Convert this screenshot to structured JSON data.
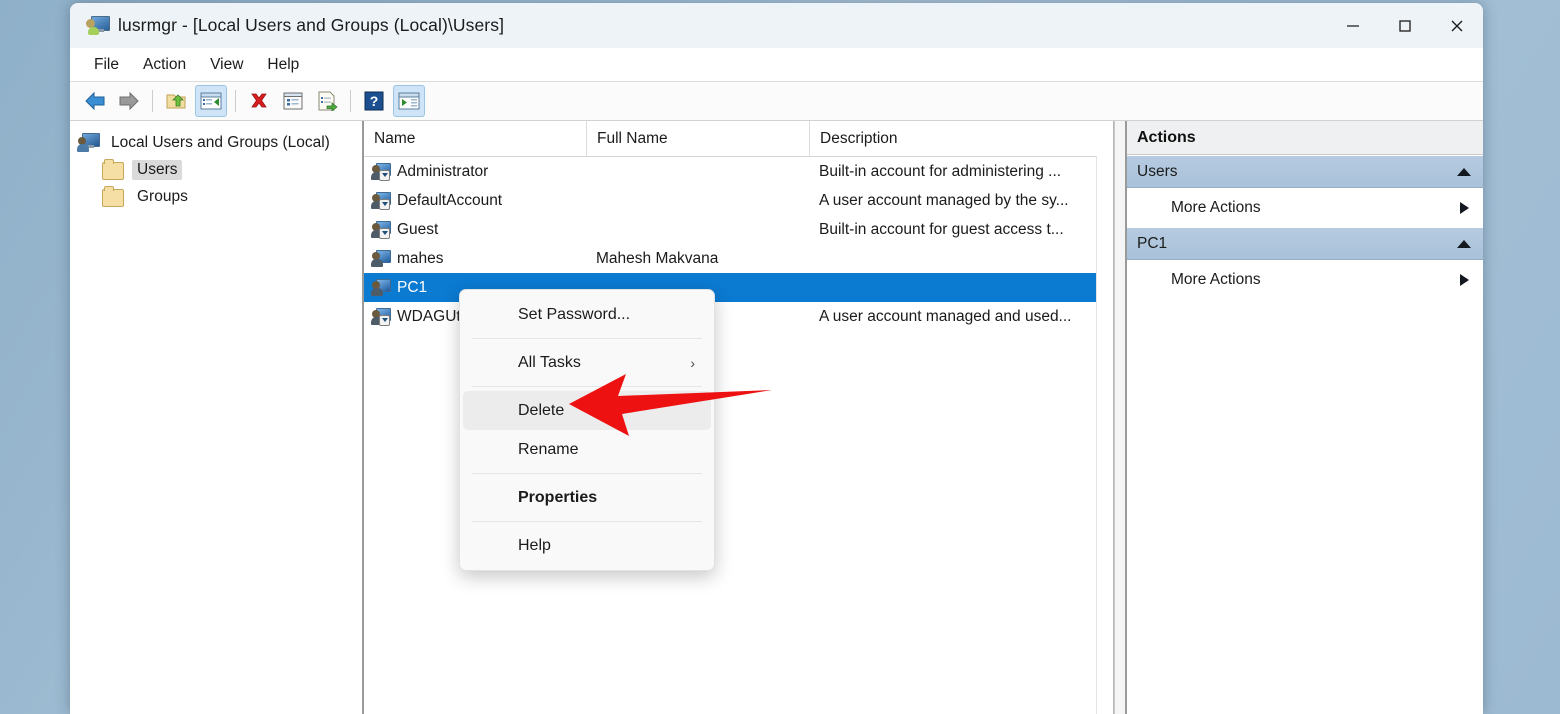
{
  "window": {
    "title": "lusrmgr - [Local Users and Groups (Local)\\Users]",
    "app_icon": "computer-users-icon",
    "controls": {
      "minimize": "minimize-icon",
      "maximize": "maximize-icon",
      "close": "close-icon"
    }
  },
  "menubar": {
    "items": [
      {
        "label": "File"
      },
      {
        "label": "Action"
      },
      {
        "label": "View"
      },
      {
        "label": "Help"
      }
    ]
  },
  "toolbar": {
    "buttons": [
      {
        "name": "back-icon",
        "glyph": "back"
      },
      {
        "name": "forward-icon",
        "glyph": "forward"
      },
      {
        "name": "up-one-level-icon",
        "glyph": "folder-up"
      },
      {
        "name": "show-hide-console-tree-icon",
        "glyph": "console-tree",
        "active": true
      },
      {
        "name": "delete-icon",
        "glyph": "delete-x"
      },
      {
        "name": "properties-icon",
        "glyph": "properties"
      },
      {
        "name": "export-list-icon",
        "glyph": "export-list"
      },
      {
        "name": "help-icon",
        "glyph": "help"
      },
      {
        "name": "show-hide-action-pane-icon",
        "glyph": "action-pane",
        "active": true
      }
    ]
  },
  "tree": {
    "root": {
      "label": "Local Users and Groups (Local)",
      "icon": "computer-icon"
    },
    "children": [
      {
        "label": "Users",
        "icon": "folder-icon",
        "selected": true
      },
      {
        "label": "Groups",
        "icon": "folder-icon",
        "selected": false
      }
    ]
  },
  "list": {
    "columns": [
      "Name",
      "Full Name",
      "Description"
    ],
    "rows": [
      {
        "name": "Administrator",
        "full_name": "",
        "description": "Built-in account for administering ...",
        "selected": false
      },
      {
        "name": "DefaultAccount",
        "full_name": "",
        "description": "A user account managed by the sy...",
        "selected": false
      },
      {
        "name": "Guest",
        "full_name": "",
        "description": "Built-in account for guest access t...",
        "selected": false
      },
      {
        "name": "mahes",
        "full_name": "Mahesh Makvana",
        "description": "",
        "selected": false
      },
      {
        "name": "PC1",
        "full_name": "",
        "description": "",
        "selected": true
      },
      {
        "name": "WDAGUtilityAccount",
        "full_name": "",
        "description": "A user account managed and used...",
        "selected": false
      }
    ]
  },
  "context_menu": {
    "items": [
      {
        "label": "Set Password...",
        "type": "item",
        "submenu": false,
        "bold": false,
        "highlighted": false
      },
      {
        "type": "separator"
      },
      {
        "label": "All Tasks",
        "type": "item",
        "submenu": true,
        "submenu_glyph": "›",
        "bold": false,
        "highlighted": false
      },
      {
        "type": "separator"
      },
      {
        "label": "Delete",
        "type": "item",
        "submenu": false,
        "bold": false,
        "highlighted": true
      },
      {
        "label": "Rename",
        "type": "item",
        "submenu": false,
        "bold": false,
        "highlighted": false
      },
      {
        "type": "separator"
      },
      {
        "label": "Properties",
        "type": "item",
        "submenu": false,
        "bold": true,
        "highlighted": false
      },
      {
        "type": "separator"
      },
      {
        "label": "Help",
        "type": "item",
        "submenu": false,
        "bold": false,
        "highlighted": false
      }
    ]
  },
  "actions": {
    "title": "Actions",
    "groups": [
      {
        "header": "Users",
        "collapse_icon": "caret-up-icon",
        "items": [
          {
            "label": "More Actions",
            "submenu_icon": "caret-right-icon"
          }
        ]
      },
      {
        "header": "PC1",
        "collapse_icon": "caret-up-icon",
        "items": [
          {
            "label": "More Actions",
            "submenu_icon": "caret-right-icon"
          }
        ]
      }
    ]
  },
  "annotation": {
    "arrow": "red-left-arrow",
    "color": "#ee1111",
    "points_at": "Delete"
  },
  "colors": {
    "selection": "#0b7ad1",
    "titlebar": "#eef3f8",
    "actions_group_header": "#aec5dd",
    "desktop": "#9cbad2",
    "annotation_red": "#ee1111"
  }
}
